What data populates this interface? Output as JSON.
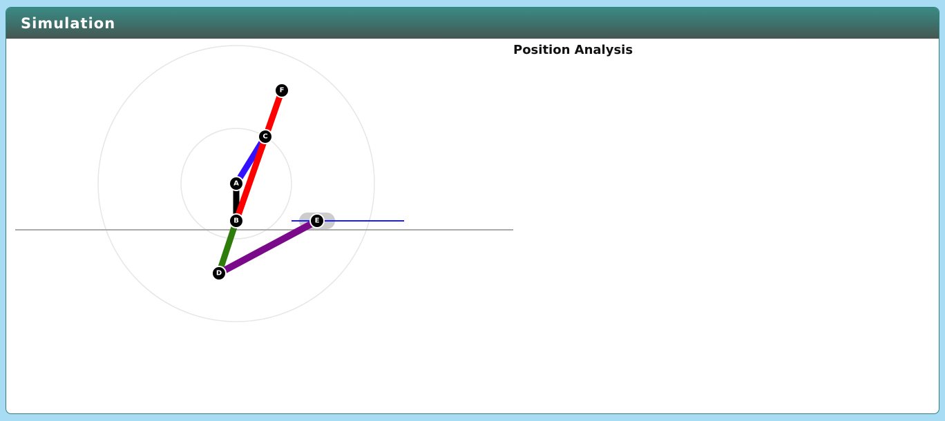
{
  "header": {
    "title": "Simulation"
  },
  "analysis": {
    "title": "Position Analysis"
  },
  "mechanism": {
    "joints": {
      "A": "A",
      "B": "B",
      "C": "C",
      "D": "D",
      "E": "E",
      "F": "F"
    },
    "colors": {
      "link_AB": "#000000",
      "link_AC": "#3311ff",
      "link_BF": "#ff0000",
      "link_BD": "#2e7d0a",
      "link_DE": "#7a0a8a",
      "slider_track": "#1a1aff",
      "ground_line": "#aaaaaa",
      "guide_circle": "#e6e6e6",
      "joint_fill": "#000000",
      "slider_block": "#cccccc"
    }
  }
}
